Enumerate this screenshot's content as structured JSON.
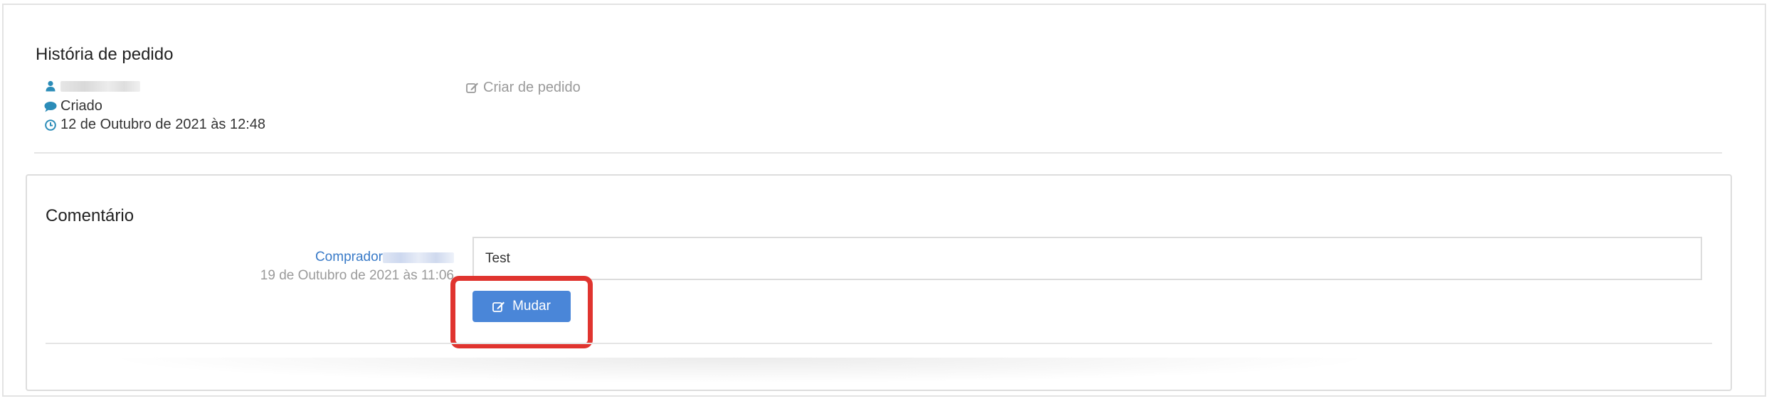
{
  "history": {
    "title": "História de pedido",
    "status": "Criado",
    "date": "12 de Outubro de 2021 às 12:48",
    "action_label": "Criar de pedido"
  },
  "comment": {
    "title": "Comentário",
    "author_label": "Comprador",
    "date": "19 de Outubro de 2021 às 11:06",
    "text": "Test",
    "edit_button_label": "Mudar"
  },
  "icons": {
    "user": "user-icon",
    "comment": "comment-icon",
    "clock": "clock-icon",
    "edit": "edit-icon"
  },
  "colors": {
    "icon_accent": "#2b8cb8",
    "link": "#3a7bc8",
    "button": "#4a86d8",
    "highlight": "#e0342f"
  }
}
